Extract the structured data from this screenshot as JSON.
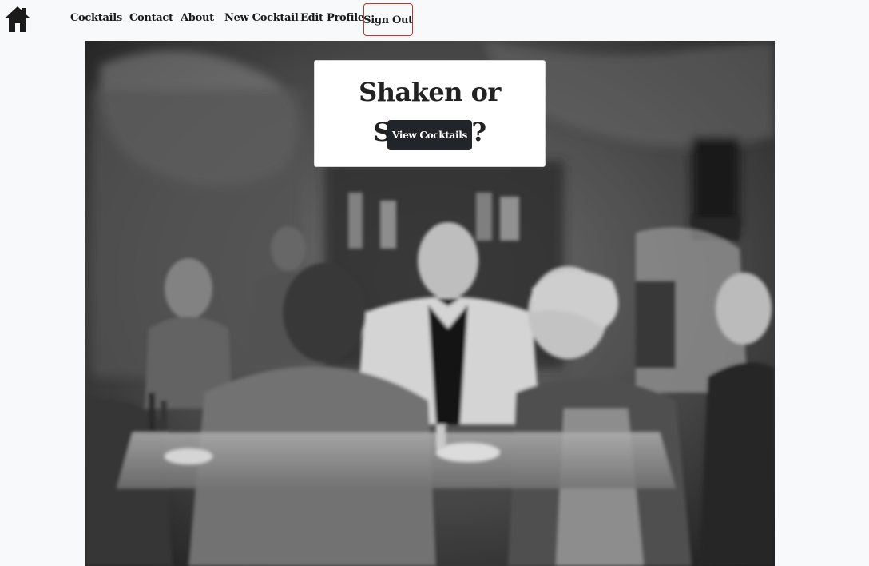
{
  "nav": {
    "home_icon": "house-icon",
    "links": {
      "cocktails": "Cocktails",
      "contact": "Contact",
      "about": "About",
      "new_cocktail": "New Cocktail",
      "edit_profile": "Edit Profile",
      "sign_out": "Sign Out"
    },
    "sign_out_border_color": "#c0392b"
  },
  "hero": {
    "title": "Shaken or Stirred?",
    "button_label": "View Cocktails",
    "image_subject": "vintage black-and-white bar scene"
  },
  "colors": {
    "background": "#f8f9fa",
    "button": "#212529",
    "text": "#1a1a1a"
  }
}
